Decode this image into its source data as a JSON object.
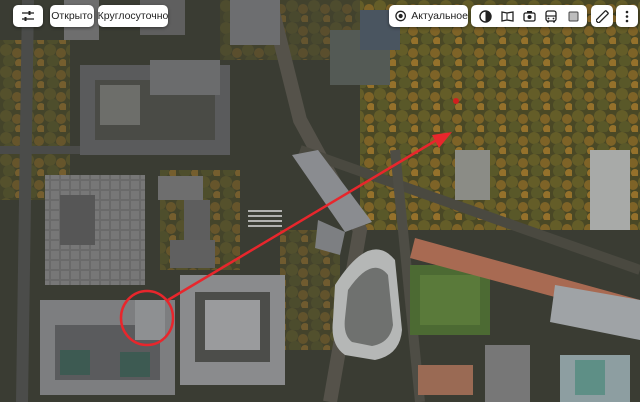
{
  "toolbar": {
    "filters_icon": "sliders-icon",
    "open_label": "Открыто",
    "hours_label": "Круглосуточно"
  },
  "map_controls": {
    "actual_label": "Актуальное",
    "layers": [
      {
        "name": "layer-satellite-button",
        "icon": "globe-icon"
      },
      {
        "name": "layer-panorama-button",
        "icon": "panorama-icon"
      },
      {
        "name": "layer-photo-button",
        "icon": "camera-icon"
      },
      {
        "name": "layer-transport-button",
        "icon": "bus-icon"
      },
      {
        "name": "layer-3d-button",
        "icon": "cube-icon"
      }
    ],
    "ruler_icon": "ruler-icon",
    "menu_icon": "more-icon"
  },
  "annotation": {
    "arrow_color": "#e8262c",
    "circle_color": "#e8262c"
  },
  "map": {
    "marker_color": "#d11f1f"
  }
}
